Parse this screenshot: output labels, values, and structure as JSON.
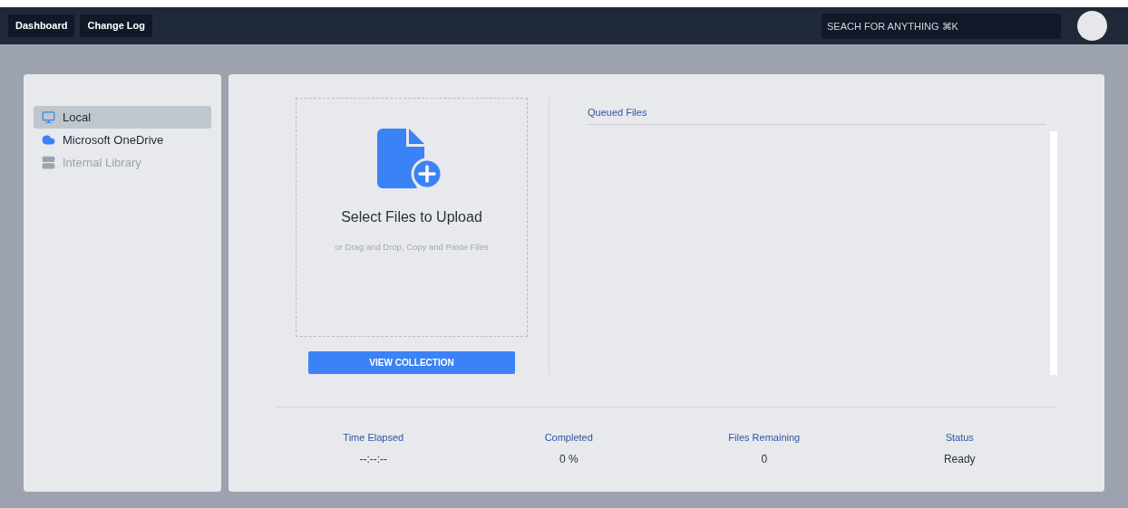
{
  "nav": {
    "buttons": [
      "Dashboard",
      "Change Log"
    ]
  },
  "search": {
    "placeholder": "SEACH FOR ANYTHING ⌘K"
  },
  "sidebar": {
    "items": [
      {
        "label": "Local",
        "kind": "monitor",
        "selected": true,
        "disabled": false
      },
      {
        "label": "Microsoft OneDrive",
        "kind": "cloud",
        "selected": false,
        "disabled": false
      },
      {
        "label": "Internal Library",
        "kind": "server",
        "selected": false,
        "disabled": true
      }
    ]
  },
  "upload": {
    "title": "Select Files to Upload",
    "hint": "or Drag and Drop, Copy and Paste Files",
    "button": "VIEW COLLECTION"
  },
  "queue": {
    "title": "Queued Files"
  },
  "stats": [
    {
      "label": "Time Elapsed",
      "value": "--:--:--"
    },
    {
      "label": "Completed",
      "value": "0 %"
    },
    {
      "label": "Files Remaining",
      "value": "0"
    },
    {
      "label": "Status",
      "value": "Ready"
    }
  ]
}
